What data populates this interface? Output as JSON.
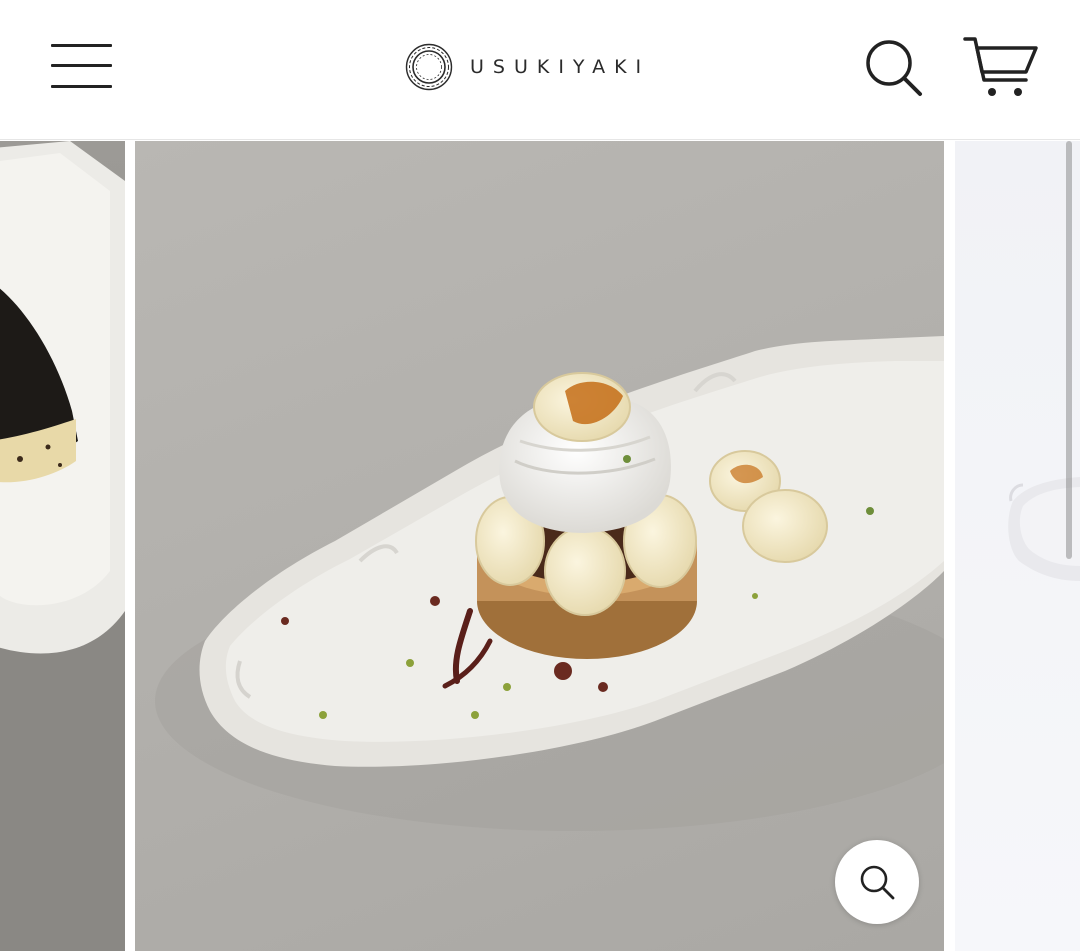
{
  "header": {
    "logo_text": "USUKIYAKI",
    "menu_icon": "hamburger-menu-icon",
    "search_icon": "search-icon",
    "cart_icon": "shopping-cart-icon"
  },
  "gallery": {
    "slides": [
      {
        "position": "previous",
        "subject": "baked-cake-on-white-plate"
      },
      {
        "position": "current",
        "subject": "banana-tart-on-scalloped-white-oval-plate"
      },
      {
        "position": "next",
        "subject": "white-scalloped-plate"
      }
    ],
    "zoom_icon": "zoom-icon"
  },
  "colors": {
    "text": "#2b2b2b",
    "header_bg": "#ffffff",
    "tabletop": "#b3b1ad",
    "plate": "#eeeeea"
  }
}
